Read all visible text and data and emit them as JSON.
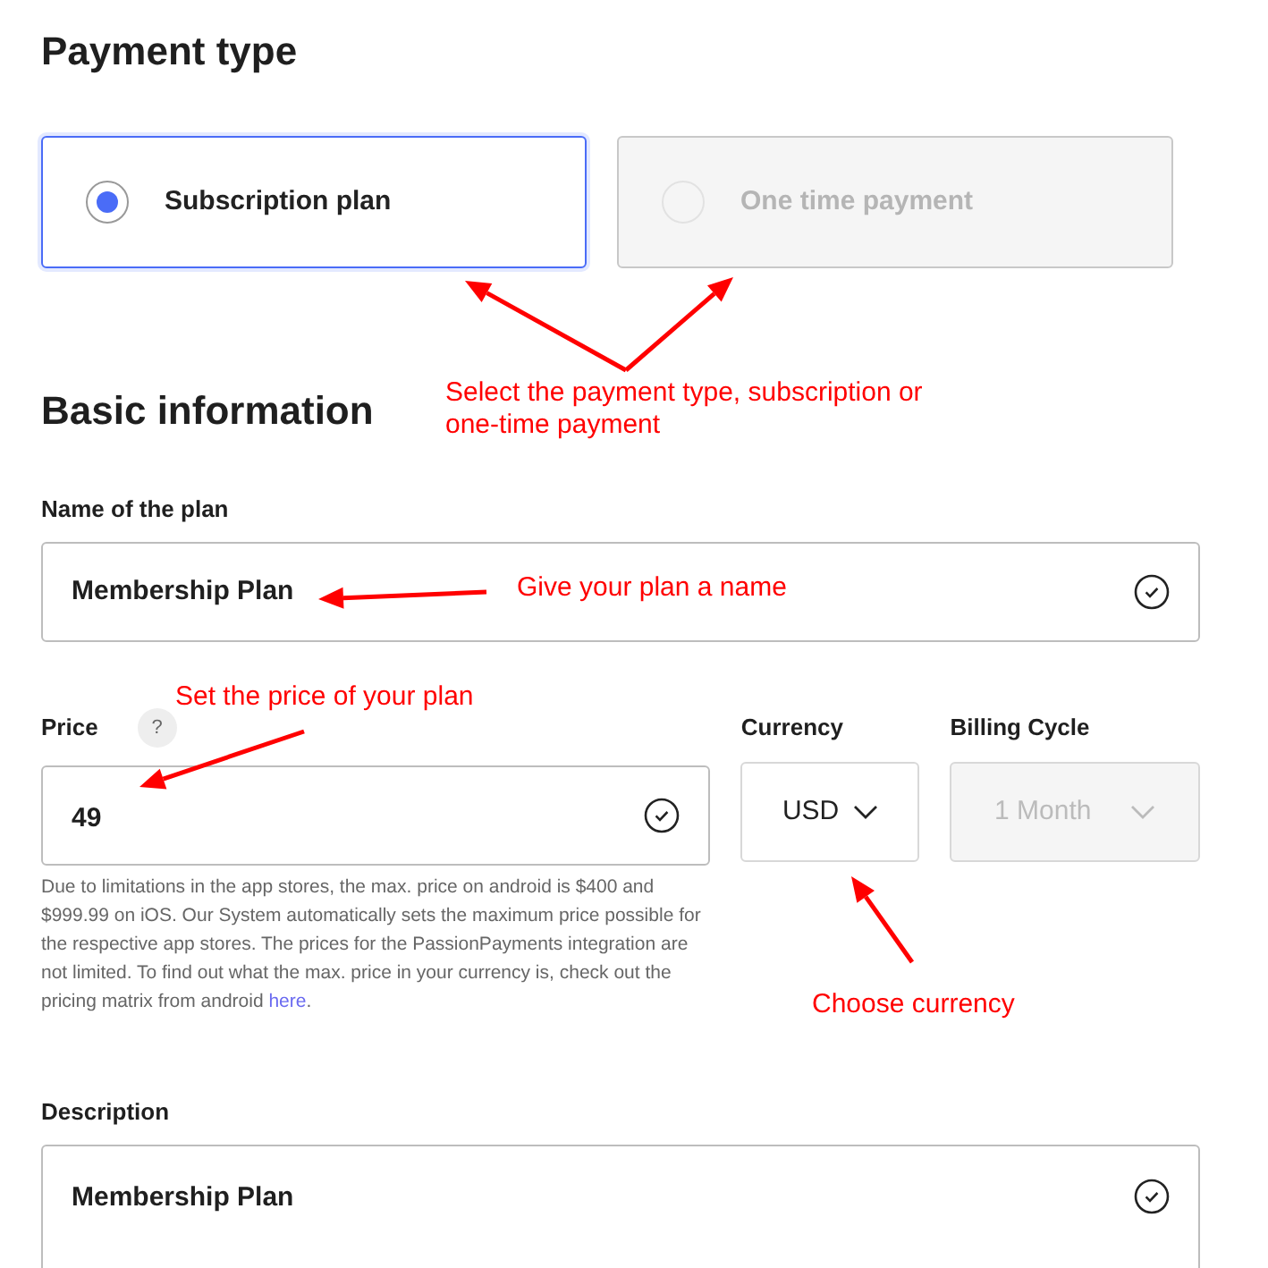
{
  "payment_type": {
    "heading": "Payment type",
    "options": [
      {
        "label": "Subscription plan",
        "selected": true,
        "disabled": false
      },
      {
        "label": "One time payment",
        "selected": false,
        "disabled": true
      }
    ]
  },
  "basic_information": {
    "heading": "Basic information",
    "name": {
      "label": "Name of the plan",
      "value": "Membership Plan",
      "valid": true
    },
    "price": {
      "label": "Price",
      "help_icon": "?",
      "value": "49",
      "valid": true,
      "note": "Due to limitations in the app stores, the max. price on android is $400 and $999.99 on iOS. Our System automatically sets the maximum price possible for the respective app stores. The prices for the PassionPayments integration are not limited. To find out what the max. price in your currency is, check out the pricing matrix from android ",
      "note_link": "here",
      "note_end": "."
    },
    "currency": {
      "label": "Currency",
      "value": "USD",
      "disabled": false
    },
    "billing_cycle": {
      "label": "Billing Cycle",
      "value": "1 Month",
      "disabled": true
    },
    "description": {
      "label": "Description",
      "value": "Membership Plan",
      "valid": true
    }
  },
  "annotations": [
    {
      "text": "Select the payment type, subscription or one-time payment"
    },
    {
      "text": "Give your plan a name"
    },
    {
      "text": "Set the price of your plan"
    },
    {
      "text": "Choose currency"
    }
  ]
}
